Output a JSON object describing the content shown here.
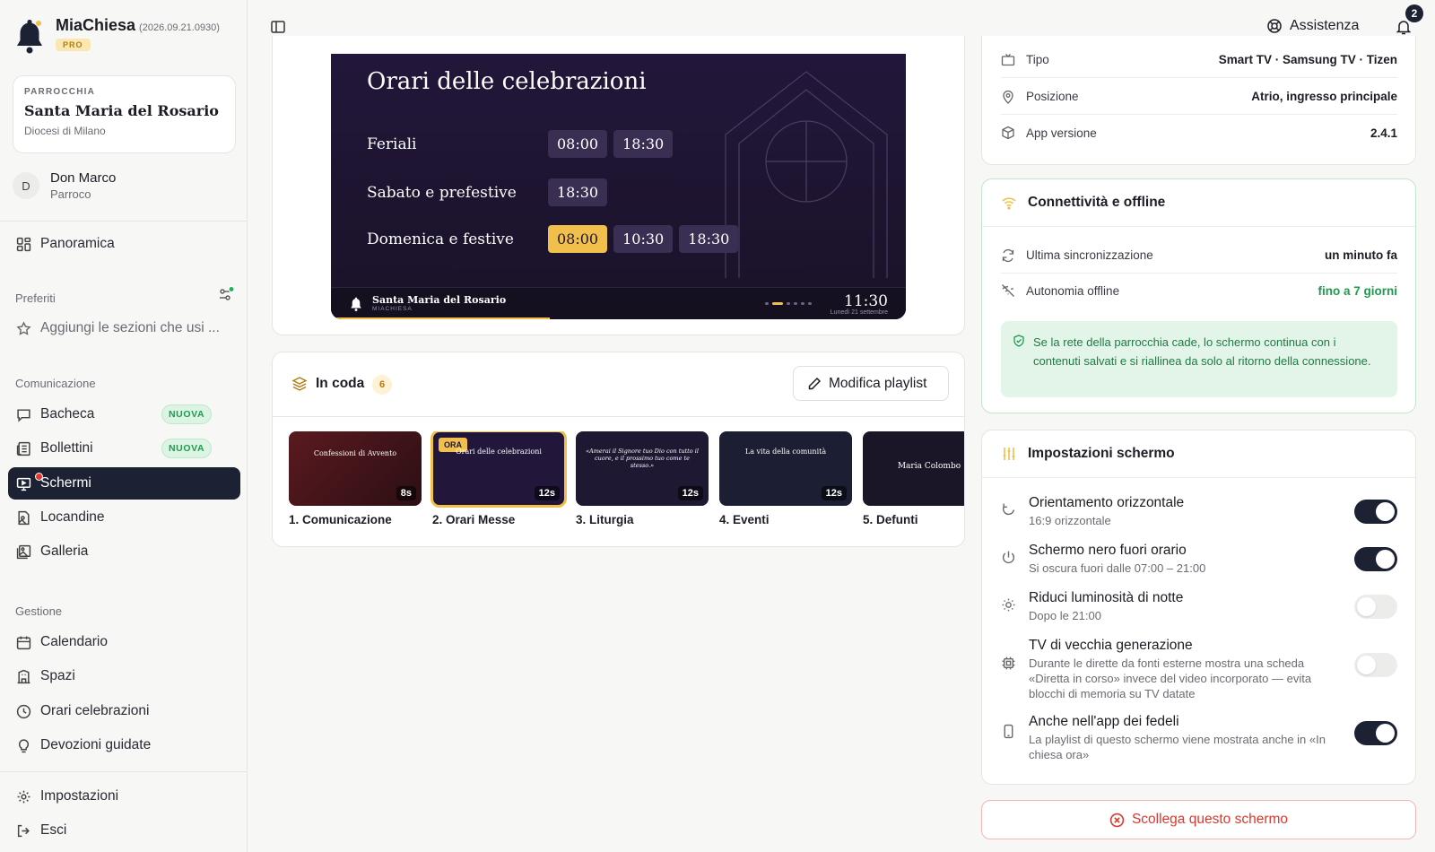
{
  "app": {
    "name": "MiaChiesa",
    "version": "(2026.09.21.0930)",
    "plan_badge": "PRO"
  },
  "parish": {
    "caption": "PARROCCHIA",
    "name": "Santa Maria del Rosario",
    "diocese": "Diocesi di Milano"
  },
  "user": {
    "initial": "D",
    "name": "Don Marco",
    "role": "Parroco"
  },
  "sidebar": {
    "overview": "Panoramica",
    "favorites_label": "Preferiti",
    "favorites_hint": "Aggiungi le sezioni che usi ...",
    "communication_label": "Comunicazione",
    "communication": [
      {
        "label": "Bacheca",
        "badge": "NUOVA"
      },
      {
        "label": "Bollettini",
        "badge": "NUOVA"
      },
      {
        "label": "Schermi",
        "badge": ""
      },
      {
        "label": "Locandine",
        "badge": ""
      },
      {
        "label": "Galleria",
        "badge": ""
      }
    ],
    "management_label": "Gestione",
    "management": [
      {
        "label": "Calendario"
      },
      {
        "label": "Spazi"
      },
      {
        "label": "Orari celebrazioni"
      },
      {
        "label": "Devozioni guidate"
      }
    ],
    "settings": "Impostazioni",
    "logout": "Esci"
  },
  "topbar": {
    "help_label": "Assistenza",
    "notifications_count": "2"
  },
  "preview": {
    "title": "Orari delle celebrazioni",
    "rows": [
      {
        "label": "Feriali",
        "times": [
          "08:00",
          "18:30"
        ]
      },
      {
        "label": "Sabato e prefestive",
        "times": [
          "18:30"
        ]
      },
      {
        "label": "Domenica e festive",
        "times": [
          "08:00",
          "10:30",
          "18:30"
        ]
      }
    ],
    "footer_church": "Santa Maria del Rosario",
    "footer_brand": "MIACHIESA",
    "clock": "11:30",
    "date": "Lunedì 21 settembre",
    "progress": 0.38
  },
  "queue": {
    "title": "In coda",
    "count": "6",
    "edit_label": "Modifica playlist",
    "items": [
      {
        "caption": "1. Comunicazione",
        "duration": "8s",
        "title": "Confessioni di Avvento",
        "now": false
      },
      {
        "caption": "2. Orari Messe",
        "duration": "12s",
        "title": "Orari delle celebrazioni",
        "now": true,
        "now_label": "ORA"
      },
      {
        "caption": "3. Liturgia",
        "duration": "12s",
        "title": "«Amerai il Signore tuo Dio con tutto il cuore, e il prossimo tuo come te stesso.»",
        "now": false
      },
      {
        "caption": "4. Eventi",
        "duration": "12s",
        "title": "La vita della comunità",
        "now": false
      },
      {
        "caption": "5. Defunti",
        "duration": "",
        "title": "Maria Colombo",
        "now": false
      }
    ]
  },
  "device": {
    "rows": [
      {
        "label": "Tipo",
        "value": "Smart TV · Samsung TV · Tizen"
      },
      {
        "label": "Posizione",
        "value": "Atrio, ingresso principale"
      },
      {
        "label": "App versione",
        "value": "2.4.1"
      }
    ]
  },
  "connectivity": {
    "title": "Connettività e offline",
    "rows": [
      {
        "label": "Ultima sincronizzazione",
        "value": "un minuto fa"
      },
      {
        "label": "Autonomia offline",
        "value": "fino a 7 giorni"
      }
    ],
    "note": "Se la rete della parrocchia cade, lo schermo continua con i contenuti salvati e si riallinea da solo al ritorno della connessione."
  },
  "settings": {
    "title": "Impostazioni schermo",
    "items": [
      {
        "title": "Orientamento orizzontale",
        "desc": "16:9 orizzontale",
        "on": true
      },
      {
        "title": "Schermo nero fuori orario",
        "desc": "Si oscura fuori dalle 07:00 – 21:00",
        "on": true
      },
      {
        "title": "Riduci luminosità di notte",
        "desc": "Dopo le 21:00",
        "on": false
      },
      {
        "title": "TV di vecchia generazione",
        "desc": "Durante le dirette da fonti esterne mostra una scheda «Diretta in corso» invece del video incorporato — evita blocchi di memoria su TV datate",
        "on": false
      },
      {
        "title": "Anche nell'app dei fedeli",
        "desc": "La playlist di questo schermo viene mostrata anche in «In chiesa ora»",
        "on": true
      }
    ]
  },
  "unlink_label": "Scollega questo schermo",
  "colors": {
    "accent_gold": "#f1c04c",
    "navy": "#1c2233",
    "success": "#1f9a4e",
    "danger": "#d9392e"
  }
}
